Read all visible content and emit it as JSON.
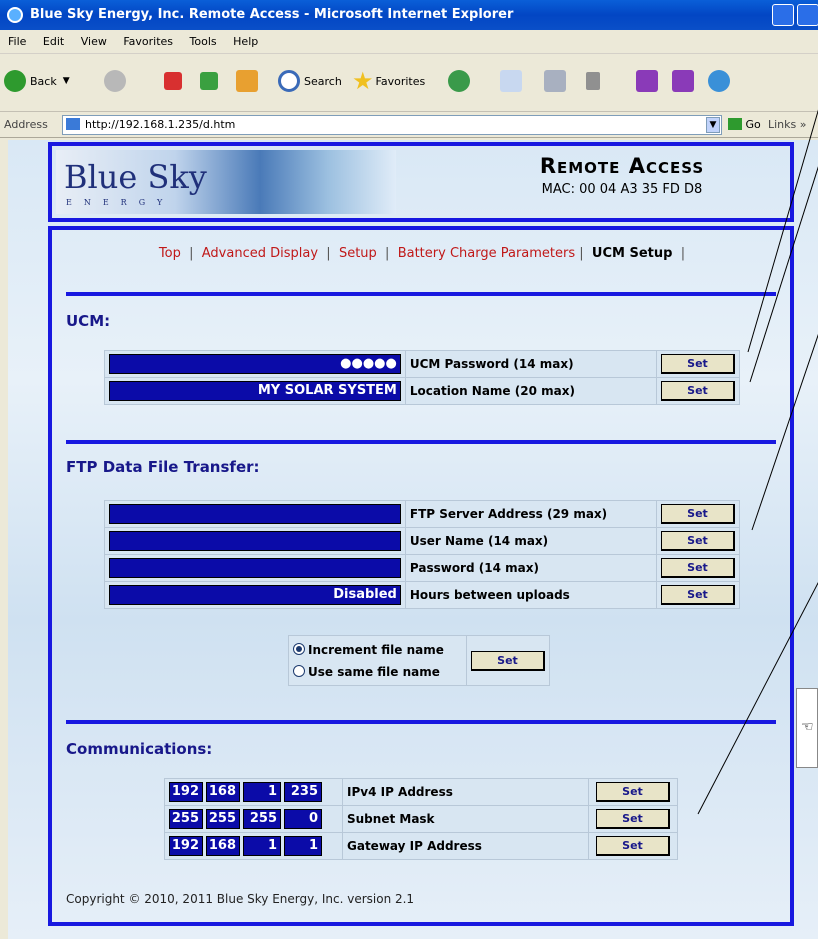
{
  "window": {
    "title": "Blue Sky Energy, Inc. Remote Access - Microsoft Internet Explorer"
  },
  "menu": [
    "File",
    "Edit",
    "View",
    "Favorites",
    "Tools",
    "Help"
  ],
  "toolbar": {
    "back": "Back",
    "search": "Search",
    "favorites": "Favorites"
  },
  "address": {
    "label": "Address",
    "url": "http://192.168.1.235/d.htm",
    "go": "Go",
    "links": "Links"
  },
  "header": {
    "logo_text": "Blue Sky",
    "logo_sub": "ENERGY",
    "title": "Remote Access",
    "mac": "MAC: 00 04 A3 35 FD D8"
  },
  "nav": {
    "items": [
      "Top",
      "Advanced Display",
      "Setup",
      "Battery Charge Parameters"
    ],
    "current": "UCM Setup"
  },
  "ucm": {
    "heading": "UCM:",
    "rows": [
      {
        "value": "●●●●●",
        "label": "UCM Password (14 max)",
        "button": "Set"
      },
      {
        "value": "MY SOLAR SYSTEM",
        "label": "Location Name (20 max)",
        "button": "Set"
      }
    ]
  },
  "ftp": {
    "heading": "FTP Data File Transfer:",
    "rows": [
      {
        "value": "",
        "label": "FTP Server Address (29 max)",
        "button": "Set"
      },
      {
        "value": "",
        "label": "User Name (14 max)",
        "button": "Set"
      },
      {
        "value": "",
        "label": "Password (14 max)",
        "button": "Set"
      },
      {
        "value": "Disabled",
        "label": "Hours between uploads",
        "button": "Set"
      }
    ],
    "radio": {
      "opt1": "Increment file name",
      "opt2": "Use same file name",
      "selected": "Increment file name",
      "button": "Set"
    }
  },
  "comms": {
    "heading": "Communications:",
    "rows": [
      {
        "octets": [
          "192",
          "168",
          "1",
          "235"
        ],
        "label": "IPv4 IP Address",
        "button": "Set"
      },
      {
        "octets": [
          "255",
          "255",
          "255",
          "0"
        ],
        "label": "Subnet Mask",
        "button": "Set"
      },
      {
        "octets": [
          "192",
          "168",
          "1",
          "1"
        ],
        "label": "Gateway IP Address",
        "button": "Set"
      }
    ]
  },
  "footer": {
    "copyright": "Copyright © 2010, 2011 Blue Sky Energy, Inc. version 2.1"
  }
}
